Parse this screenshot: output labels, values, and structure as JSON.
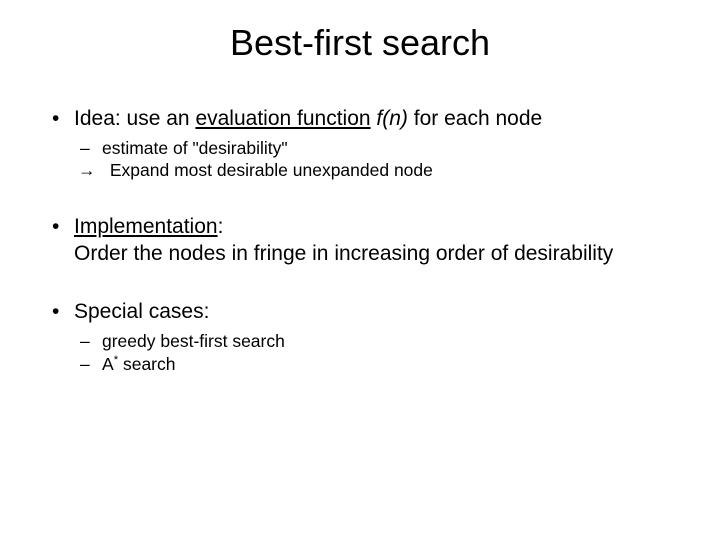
{
  "title": "Best-first search",
  "b1": {
    "lead": "Idea: use an ",
    "eval_u": "evaluation function",
    "space": " ",
    "fn_i": "f(n)",
    "tail": " for each node",
    "sub1": "estimate of \"desirability\"",
    "sub2_arrow": "→",
    "sub2_text": " Expand most desirable unexpanded node"
  },
  "b2": {
    "impl_u": "Implementation",
    "colon": ":",
    "line2": "Order the nodes in fringe in increasing order of desirability"
  },
  "b3": {
    "lead": "Special cases:",
    "sub1": "greedy best-first search",
    "sub2_a": "A",
    "sub2_star": "*",
    "sub2_tail": " search"
  }
}
